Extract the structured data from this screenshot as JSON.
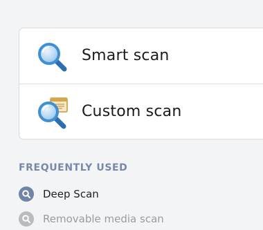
{
  "scan_options": [
    {
      "label": "Smart scan",
      "icon": "magnifier-icon"
    },
    {
      "label": "Custom scan",
      "icon": "magnifier-with-document-icon"
    }
  ],
  "frequently_used": {
    "title": "FREQUENTLY USED",
    "items": [
      {
        "label": "Deep Scan",
        "icon": "search-icon",
        "state": "active"
      },
      {
        "label": "Removable media scan",
        "icon": "search-icon",
        "state": "disabled"
      }
    ]
  },
  "colors": {
    "accent": "#6f84a6",
    "section_title": "#7789a7",
    "magnifier_blue": "#3f8fd3",
    "disabled_gray": "#b9bbbf"
  }
}
